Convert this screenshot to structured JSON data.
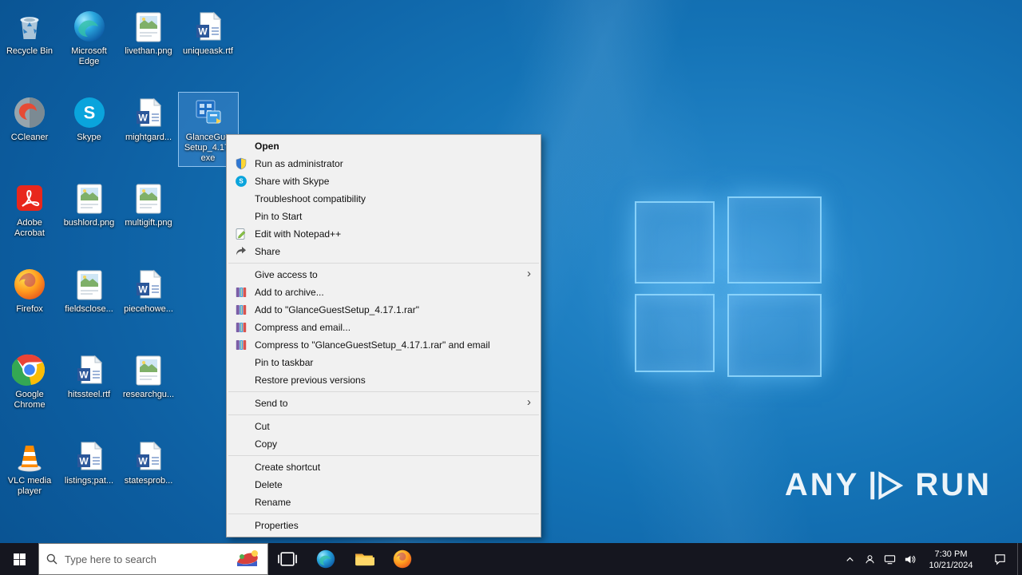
{
  "colors": {
    "accent": "#0078d7",
    "taskbar": "#15161f",
    "menu_background": "#f1f1f1",
    "selection": "rgba(70,140,210,0.48)"
  },
  "desktop": {
    "icons": [
      {
        "label": "Recycle Bin",
        "icon": "recycle-bin",
        "col": 0,
        "row": 0
      },
      {
        "label": "Microsoft Edge",
        "icon": "edge",
        "col": 1,
        "row": 0
      },
      {
        "label": "livethan.png",
        "icon": "image-file",
        "col": 2,
        "row": 0
      },
      {
        "label": "uniqueask.rtf",
        "icon": "word-doc",
        "col": 3,
        "row": 0
      },
      {
        "label": "CCleaner",
        "icon": "ccleaner",
        "col": 0,
        "row": 1
      },
      {
        "label": "Skype",
        "icon": "skype",
        "col": 1,
        "row": 1
      },
      {
        "label": "mightgard...",
        "icon": "word-doc",
        "col": 2,
        "row": 1
      },
      {
        "label": "GlanceGue Setup_4.17. exe",
        "icon": "installer",
        "col": 3,
        "row": 1,
        "selected": true
      },
      {
        "label": "Adobe Acrobat",
        "icon": "acrobat",
        "col": 0,
        "row": 2
      },
      {
        "label": "bushlord.png",
        "icon": "image-file",
        "col": 1,
        "row": 2
      },
      {
        "label": "multigift.png",
        "icon": "image-file",
        "col": 2,
        "row": 2
      },
      {
        "label": "Firefox",
        "icon": "firefox",
        "col": 0,
        "row": 3
      },
      {
        "label": "fieldsclose...",
        "icon": "image-file",
        "col": 1,
        "row": 3
      },
      {
        "label": "piecehowe...",
        "icon": "word-doc",
        "col": 2,
        "row": 3
      },
      {
        "label": "Google Chrome",
        "icon": "chrome",
        "col": 0,
        "row": 4
      },
      {
        "label": "hitssteel.rtf",
        "icon": "word-doc",
        "col": 1,
        "row": 4
      },
      {
        "label": "researchgu...",
        "icon": "image-file",
        "col": 2,
        "row": 4
      },
      {
        "label": "VLC media player",
        "icon": "vlc",
        "col": 0,
        "row": 5
      },
      {
        "label": "listings;pat...",
        "icon": "word-doc",
        "col": 1,
        "row": 5
      },
      {
        "label": "statesprob...",
        "icon": "word-doc",
        "col": 2,
        "row": 5
      }
    ]
  },
  "context_menu": {
    "items": [
      {
        "label": "Open",
        "bold": true
      },
      {
        "label": "Run as administrator",
        "icon": "uac-shield"
      },
      {
        "label": "Share with Skype",
        "icon": "skype"
      },
      {
        "label": "Troubleshoot compatibility"
      },
      {
        "label": "Pin to Start"
      },
      {
        "label": "Edit with Notepad++",
        "icon": "notepadpp"
      },
      {
        "label": "Share",
        "icon": "share"
      },
      {
        "separator": true
      },
      {
        "label": "Give access to",
        "submenu": true
      },
      {
        "label": "Add to archive...",
        "icon": "winrar"
      },
      {
        "label": "Add to \"GlanceGuestSetup_4.17.1.rar\"",
        "icon": "winrar"
      },
      {
        "label": "Compress and email...",
        "icon": "winrar"
      },
      {
        "label": "Compress to \"GlanceGuestSetup_4.17.1.rar\" and email",
        "icon": "winrar"
      },
      {
        "label": "Pin to taskbar"
      },
      {
        "label": "Restore previous versions"
      },
      {
        "separator": true
      },
      {
        "label": "Send to",
        "submenu": true
      },
      {
        "separator": true
      },
      {
        "label": "Cut"
      },
      {
        "label": "Copy"
      },
      {
        "separator": true
      },
      {
        "label": "Create shortcut"
      },
      {
        "label": "Delete"
      },
      {
        "label": "Rename"
      },
      {
        "separator": true
      },
      {
        "label": "Properties"
      }
    ]
  },
  "taskbar": {
    "search_placeholder": "Type here to search",
    "app_buttons": [
      "task-view",
      "edge",
      "file-explorer",
      "firefox"
    ],
    "tray_icons": [
      "chevron-up",
      "contact-person",
      "network-display",
      "volume"
    ],
    "clock": {
      "time": "7:30 PM",
      "date": "10/21/2024"
    }
  },
  "watermark": {
    "left": "ANY",
    "right": "RUN"
  }
}
